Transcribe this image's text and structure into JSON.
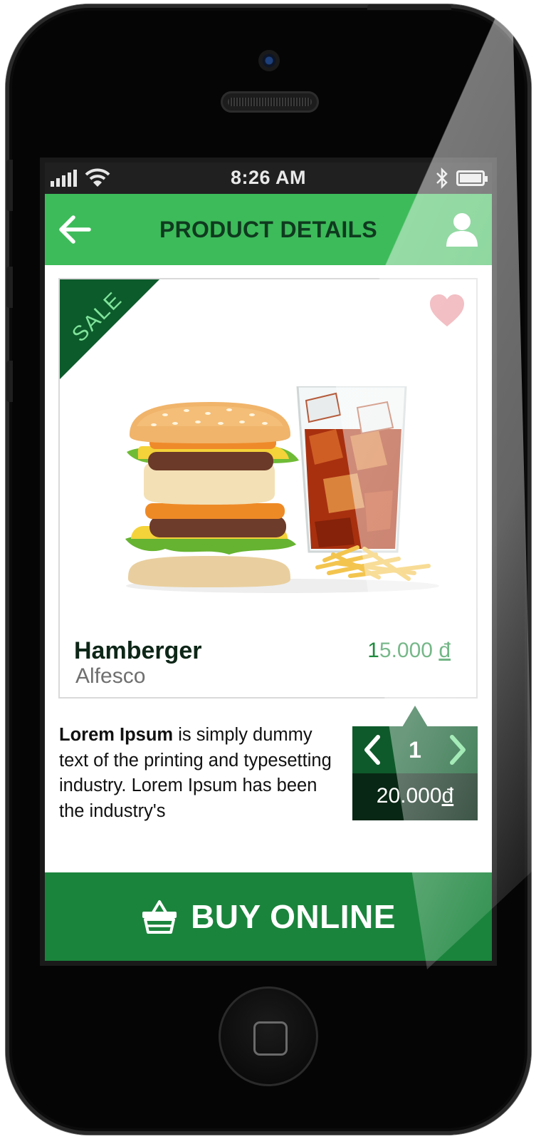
{
  "status_bar": {
    "time": "8:26 AM"
  },
  "header": {
    "title": "PRODUCT DETAILS"
  },
  "product": {
    "badge": "SALE",
    "name": "Hamberger",
    "brand": "Alfesco",
    "price_value": "15.000 ",
    "price_currency": "đ"
  },
  "description": {
    "bold": "Lorem Ipsum",
    "text": " is simply dummy text of the printing and typesetting industry. Lorem Ipsum has been the industry's"
  },
  "quantity": {
    "value": "1",
    "total_value": "20.000",
    "total_currency": "đ"
  },
  "buy_button": {
    "label": "BUY ONLINE"
  },
  "colors": {
    "header_green": "#3dbb5a",
    "dark_green": "#0e5a2b",
    "buy_green": "#1a843c",
    "price_green": "#1f8a3e",
    "heart_pink": "#e88f98"
  },
  "icons": {
    "back": "arrow-left-icon",
    "user": "user-icon",
    "favorite": "heart-icon",
    "prev": "chevron-left-icon",
    "next": "chevron-right-icon",
    "cart": "basket-icon"
  }
}
